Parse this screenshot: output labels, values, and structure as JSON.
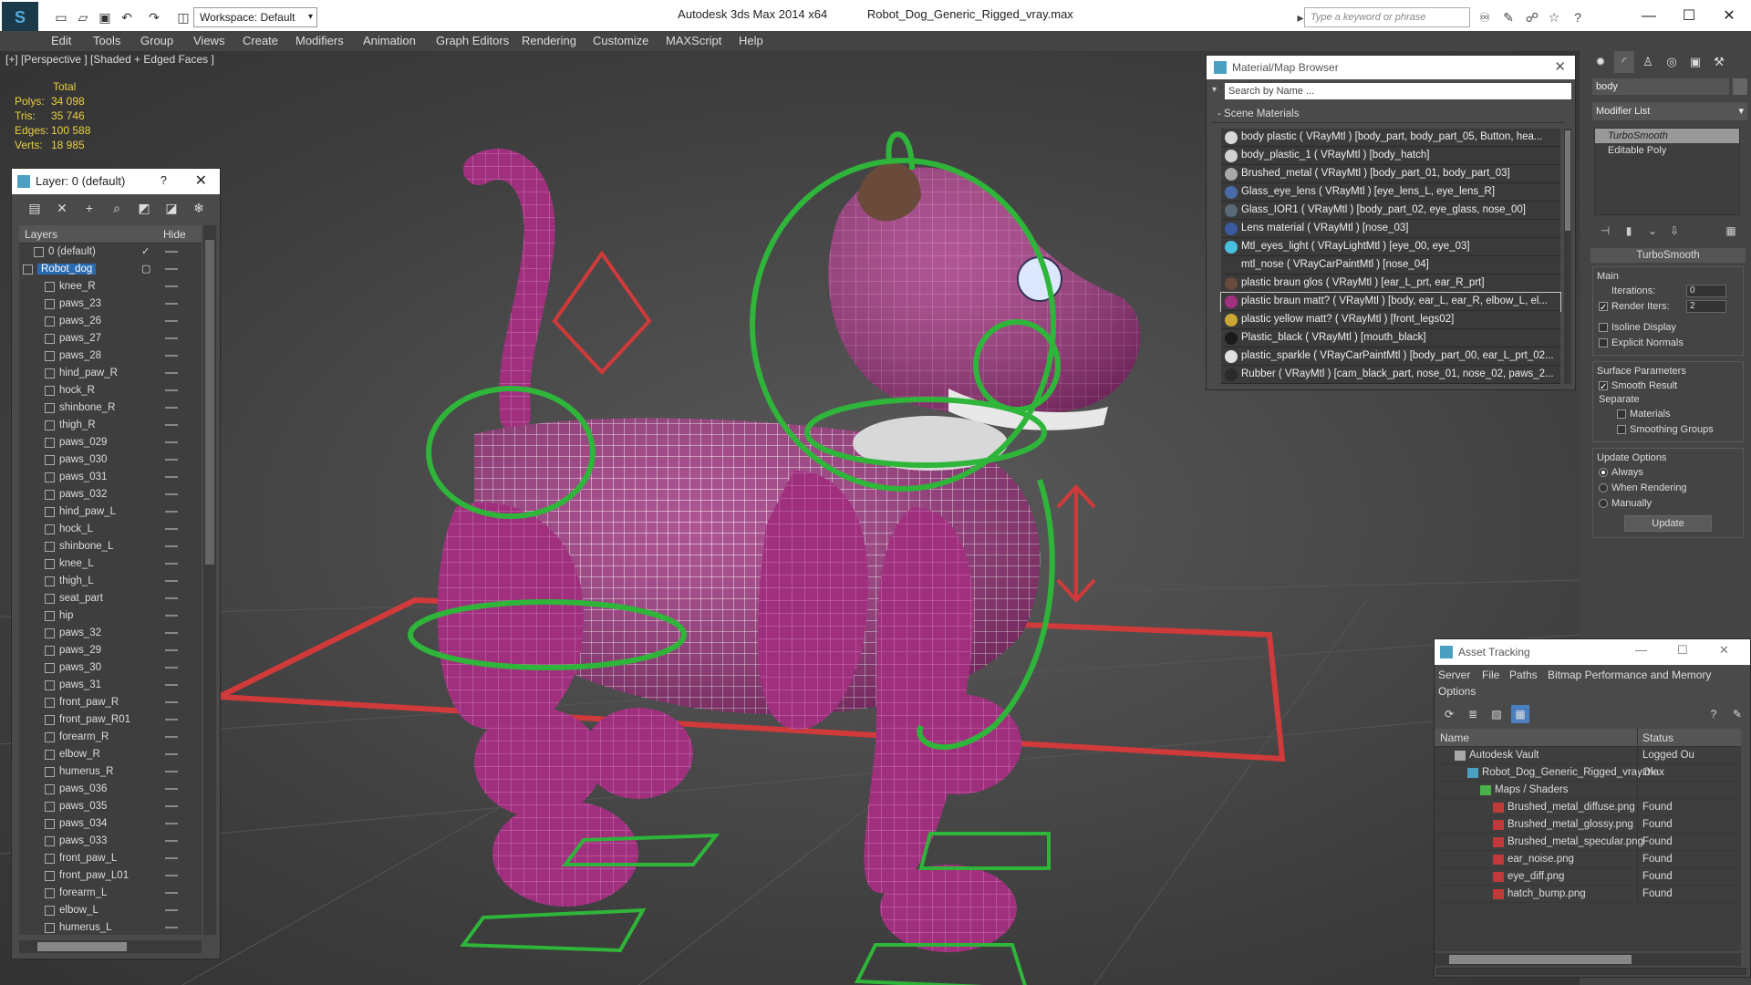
{
  "window": {
    "app_title": "Autodesk 3ds Max  2014 x64",
    "file_title": "Robot_Dog_Generic_Rigged_vray.max",
    "workspace": "Workspace: Default",
    "search_placeholder": "Type a keyword or phrase"
  },
  "menu": [
    "Edit",
    "Tools",
    "Group",
    "Views",
    "Create",
    "Modifiers",
    "Animation",
    "Graph Editors",
    "Rendering",
    "Customize",
    "MAXScript",
    "Help"
  ],
  "viewport": {
    "label": "[+] [Perspective ] [Shaded + Edged Faces ]",
    "stats_header": "Total",
    "stats": [
      {
        "label": "Polys:",
        "value": "34 098"
      },
      {
        "label": "Tris:",
        "value": "35 746"
      },
      {
        "label": "Edges:",
        "value": "100 588"
      },
      {
        "label": "Verts:",
        "value": "18 985"
      }
    ]
  },
  "layer_panel": {
    "title": "Layer: 0 (default)",
    "help": "?",
    "col_layers": "Layers",
    "col_hide": "Hide",
    "rows": [
      {
        "name": "0 (default)",
        "level": 1
      },
      {
        "name": "Robot_dog",
        "level": 0
      },
      {
        "name": "knee_R",
        "level": 2
      },
      {
        "name": "paws_23",
        "level": 2
      },
      {
        "name": "paws_26",
        "level": 2
      },
      {
        "name": "paws_27",
        "level": 2
      },
      {
        "name": "paws_28",
        "level": 2
      },
      {
        "name": "hind_paw_R",
        "level": 2
      },
      {
        "name": "hock_R",
        "level": 2
      },
      {
        "name": "shinbone_R",
        "level": 2
      },
      {
        "name": "thigh_R",
        "level": 2
      },
      {
        "name": "paws_029",
        "level": 2
      },
      {
        "name": "paws_030",
        "level": 2
      },
      {
        "name": "paws_031",
        "level": 2
      },
      {
        "name": "paws_032",
        "level": 2
      },
      {
        "name": "hind_paw_L",
        "level": 2
      },
      {
        "name": "hock_L",
        "level": 2
      },
      {
        "name": "shinbone_L",
        "level": 2
      },
      {
        "name": "knee_L",
        "level": 2
      },
      {
        "name": "thigh_L",
        "level": 2
      },
      {
        "name": "seat_part",
        "level": 2
      },
      {
        "name": "hip",
        "level": 2
      },
      {
        "name": "paws_32",
        "level": 2
      },
      {
        "name": "paws_29",
        "level": 2
      },
      {
        "name": "paws_30",
        "level": 2
      },
      {
        "name": "paws_31",
        "level": 2
      },
      {
        "name": "front_paw_R",
        "level": 2
      },
      {
        "name": "front_paw_R01",
        "level": 2
      },
      {
        "name": "forearm_R",
        "level": 2
      },
      {
        "name": "elbow_R",
        "level": 2
      },
      {
        "name": "humerus_R",
        "level": 2
      },
      {
        "name": "paws_036",
        "level": 2
      },
      {
        "name": "paws_035",
        "level": 2
      },
      {
        "name": "paws_034",
        "level": 2
      },
      {
        "name": "paws_033",
        "level": 2
      },
      {
        "name": "front_paw_L",
        "level": 2
      },
      {
        "name": "front_paw_L01",
        "level": 2
      },
      {
        "name": "forearm_L",
        "level": 2
      },
      {
        "name": "elbow_L",
        "level": 2
      },
      {
        "name": "humerus_L",
        "level": 2
      }
    ]
  },
  "material_browser": {
    "title": "Material/Map Browser",
    "search": "Search by Name ...",
    "section": "- Scene Materials",
    "materials": [
      {
        "name": "body plastic  ( VRayMtl ) [body_part, body_part_05, Button, hea...",
        "color": "#d8d8d8"
      },
      {
        "name": "body_plastic_1  ( VRayMtl ) [body_hatch]",
        "color": "#d0d0d0"
      },
      {
        "name": "Brushed_metal  ( VRayMtl ) [body_part_01, body_part_03]",
        "color": "#a8a8a8"
      },
      {
        "name": "Glass_eye_lens  ( VRayMtl ) [eye_lens_L, eye_lens_R]",
        "color": "#4a6aa8"
      },
      {
        "name": "Glass_IOR1  ( VRayMtl ) [body_part_02, eye_glass, nose_00]",
        "color": "#5a6a78"
      },
      {
        "name": "Lens material  ( VRayMtl ) [nose_03]",
        "color": "#3a5aa0"
      },
      {
        "name": "Mtl_eyes_light  ( VRayLightMtl ) [eye_00, eye_03]",
        "color": "#4ac0e0"
      },
      {
        "name": "mtl_nose  ( VRayCarPaintMtl ) [nose_04]",
        "color": "#3a3a3a"
      },
      {
        "name": "plastic braun glos  ( VRayMtl ) [ear_L_prt, ear_R_prt]",
        "color": "#6a4a3a"
      },
      {
        "name": "plastic braun matt?  ( VRayMtl ) [body, ear_L, ear_R, elbow_L, el...",
        "color": "#a03080"
      },
      {
        "name": "plastic yellow matt?  ( VRayMtl ) [front_legs02]",
        "color": "#c8a830"
      },
      {
        "name": "Plastic_black  ( VRayMtl ) [mouth_black]",
        "color": "#1a1a1a"
      },
      {
        "name": "plastic_sparkle  ( VRayCarPaintMtl ) [body_part_00, ear_L_prt_02...",
        "color": "#e0e0e0"
      },
      {
        "name": "Rubber  ( VRayMtl ) [cam_black_part, nose_01, nose_02, paws_2...",
        "color": "#2a2a2a"
      }
    ]
  },
  "command_panel": {
    "object_name": "body",
    "modifier_list": "Modifier List",
    "stack": [
      "TurboSmooth",
      "Editable Poly"
    ],
    "rollout_title": "TurboSmooth",
    "main_label": "Main",
    "iterations_label": "Iterations:",
    "iterations_value": "0",
    "render_iters_label": "Render Iters:",
    "render_iters_value": "2",
    "isoline": "Isoline Display",
    "explicit_normals": "Explicit Normals",
    "surface_params": "Surface Parameters",
    "smooth_result": "Smooth Result",
    "separate": "Separate",
    "materials": "Materials",
    "smoothing_groups": "Smoothing Groups",
    "update_options": "Update Options",
    "always": "Always",
    "when_rendering": "When Rendering",
    "manually": "Manually",
    "update_button": "Update"
  },
  "asset_tracking": {
    "title": "Asset Tracking",
    "menu": [
      "Server",
      "File",
      "Paths",
      "Bitmap Performance and Memory",
      "Options"
    ],
    "col_name": "Name",
    "col_status": "Status",
    "rows": [
      {
        "name": "Autodesk Vault",
        "status": "Logged Ou",
        "level": 0,
        "icon": "vault"
      },
      {
        "name": "Robot_Dog_Generic_Rigged_vray.max",
        "status": "Ok",
        "level": 1,
        "icon": "max"
      },
      {
        "name": "Maps / Shaders",
        "status": "",
        "level": 2,
        "icon": "maps"
      },
      {
        "name": "Brushed_metal_diffuse.png",
        "status": "Found",
        "level": 3,
        "icon": "png"
      },
      {
        "name": "Brushed_metal_glossy.png",
        "status": "Found",
        "level": 3,
        "icon": "png"
      },
      {
        "name": "Brushed_metal_specular.png",
        "status": "Found",
        "level": 3,
        "icon": "png"
      },
      {
        "name": "ear_noise.png",
        "status": "Found",
        "level": 3,
        "icon": "png"
      },
      {
        "name": "eye_diff.png",
        "status": "Found",
        "level": 3,
        "icon": "png"
      },
      {
        "name": "hatch_bump.png",
        "status": "Found",
        "level": 3,
        "icon": "png"
      }
    ]
  }
}
